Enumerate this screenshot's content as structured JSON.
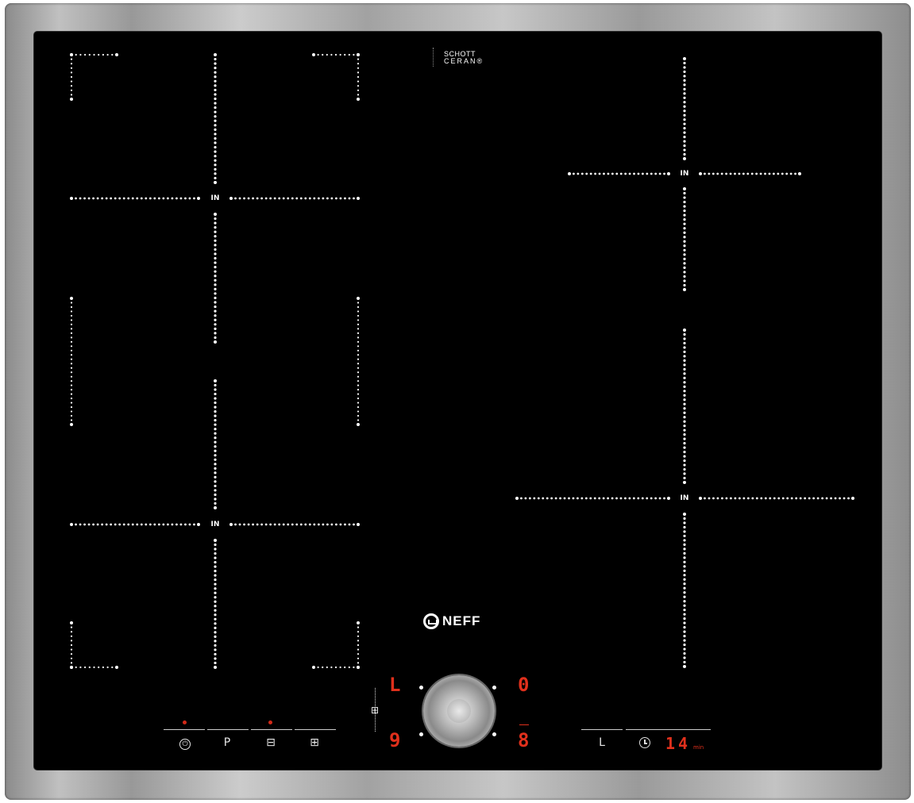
{
  "glass_brand": {
    "line1": "SCHOTT",
    "line2": "CERAN®"
  },
  "appliance_brand": {
    "name": "NEFF"
  },
  "zones": {
    "in_label": "IN"
  },
  "controls": {
    "power_icon": "power-icon",
    "power_symbol": "⏻",
    "program_label": "P",
    "flex_icon": "flex-zone-icon",
    "flex_symbol": "⊟",
    "boost_icon": "boost-icon",
    "boost_symbol": "⊞"
  },
  "knob_display": {
    "top_left": "L",
    "top_right": "0",
    "bottom_left": "9",
    "bottom_right": "8",
    "side_icon_symbol": "⊞"
  },
  "timer": {
    "lock_label": "L",
    "clock_icon": "clock-icon",
    "value": "14",
    "unit": "min"
  },
  "colors": {
    "display_red": "#e0301c",
    "glass": "#000000",
    "marking_white": "#ffffff"
  }
}
